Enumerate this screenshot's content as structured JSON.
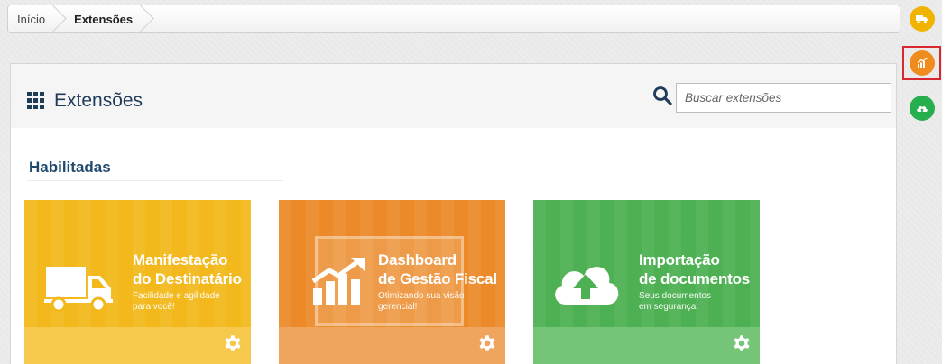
{
  "breadcrumb": {
    "home": "Início",
    "current": "Extensões"
  },
  "side_buttons": [
    {
      "icon": "truck-icon",
      "color": "#f0b400"
    },
    {
      "icon": "chart-icon",
      "color": "#f08c1e",
      "selected": true
    },
    {
      "icon": "cloud-upload-icon",
      "color": "#27ae4f"
    }
  ],
  "page": {
    "title": "Extensões"
  },
  "search": {
    "placeholder": "Buscar extensões",
    "value": ""
  },
  "section": {
    "title": "Habilitadas"
  },
  "cards": [
    {
      "title_line1": "Manifestação",
      "title_line2": "do Destinatário",
      "sub_line1": "Facilidade e agilidade",
      "sub_line2": "para você!",
      "icon": "truck-icon",
      "color": "#f2b81c",
      "footer_color": "#f6c94d"
    },
    {
      "title_line1": "Dashboard",
      "title_line2": "de Gestão Fiscal",
      "sub_line1": "Otimizando sua visão",
      "sub_line2": "gerencial!",
      "icon": "chart-icon",
      "color": "#ec8a2a",
      "footer_color": "#f0a55f"
    },
    {
      "title_line1": "Importação",
      "title_line2": "de documentos",
      "sub_line1": "Seus documentos",
      "sub_line2": "em segurança.",
      "icon": "cloud-upload-icon",
      "color": "#4db052",
      "footer_color": "#74c577"
    }
  ]
}
